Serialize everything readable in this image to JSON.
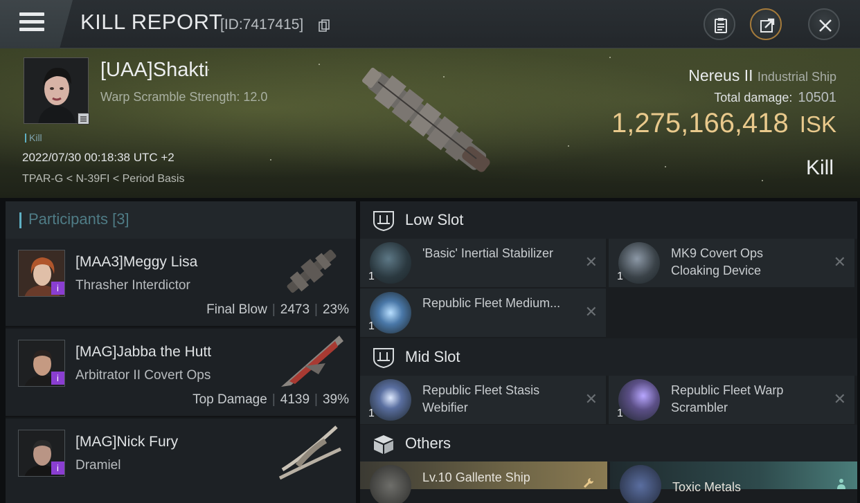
{
  "titlebar": {
    "title": "KILL REPORT",
    "id_text": "[ID:7417415]"
  },
  "victim": {
    "name": "[UAA]Shakti",
    "warp_scramble": "Warp Scramble Strength: 12.0",
    "tag": "Kill",
    "datetime": "2022/07/30 00:18:38 UTC +2",
    "route": "TPAR-G < N-39FI < Period Basis",
    "ship_name": "Nereus II",
    "ship_class": "Industrial Ship",
    "total_damage_label": "Total damage:",
    "total_damage_value": "10501",
    "isk_value": "1,275,166,418",
    "isk_unit": "ISK",
    "result": "Kill"
  },
  "participants": {
    "label": "Participants",
    "count": "[3]",
    "rows": [
      {
        "name": "[MAA3]Meggy Lisa",
        "ship": "Thrasher Interdictor",
        "role": "Final Blow",
        "damage": "2473",
        "percent": "23%",
        "badge": "i"
      },
      {
        "name": "[MAG]Jabba the Hutt",
        "ship": "Arbitrator II Covert Ops",
        "role": "Top Damage",
        "damage": "4139",
        "percent": "39%",
        "badge": "i"
      },
      {
        "name": "[MAG]Nick Fury",
        "ship": "Dramiel",
        "badge": "i"
      }
    ]
  },
  "fitting": {
    "low_slot": {
      "label": "Low Slot",
      "modules": [
        {
          "name": "'Basic' Inertial Stabilizer",
          "qty": "1"
        },
        {
          "name": "MK9 Covert Ops Cloaking Device",
          "qty": "1"
        },
        {
          "name": "Republic Fleet Medium...",
          "qty": "1"
        }
      ]
    },
    "mid_slot": {
      "label": "Mid Slot",
      "modules": [
        {
          "name": "Republic Fleet Stasis Webifier",
          "qty": "1"
        },
        {
          "name": "Republic Fleet Warp Scrambler",
          "qty": "1"
        }
      ]
    },
    "others": {
      "label": "Others",
      "items": [
        {
          "name": "Lv.10 Gallente Ship"
        },
        {
          "name": "Toxic Metals"
        }
      ]
    },
    "close_glyph": "✕"
  },
  "colors": {
    "isk": "#e9c98c",
    "accent_teal": "#5fb0c4",
    "badge_purple": "#8a3ed1",
    "others_gold": "#8a7a52",
    "others_teal": "#4a7d7a"
  },
  "icons": [
    "hamburger-icon",
    "copy-icon",
    "clipboard-icon",
    "share-icon",
    "close-icon",
    "shield-icon",
    "box-icon",
    "wrench-icon",
    "person-icon"
  ]
}
